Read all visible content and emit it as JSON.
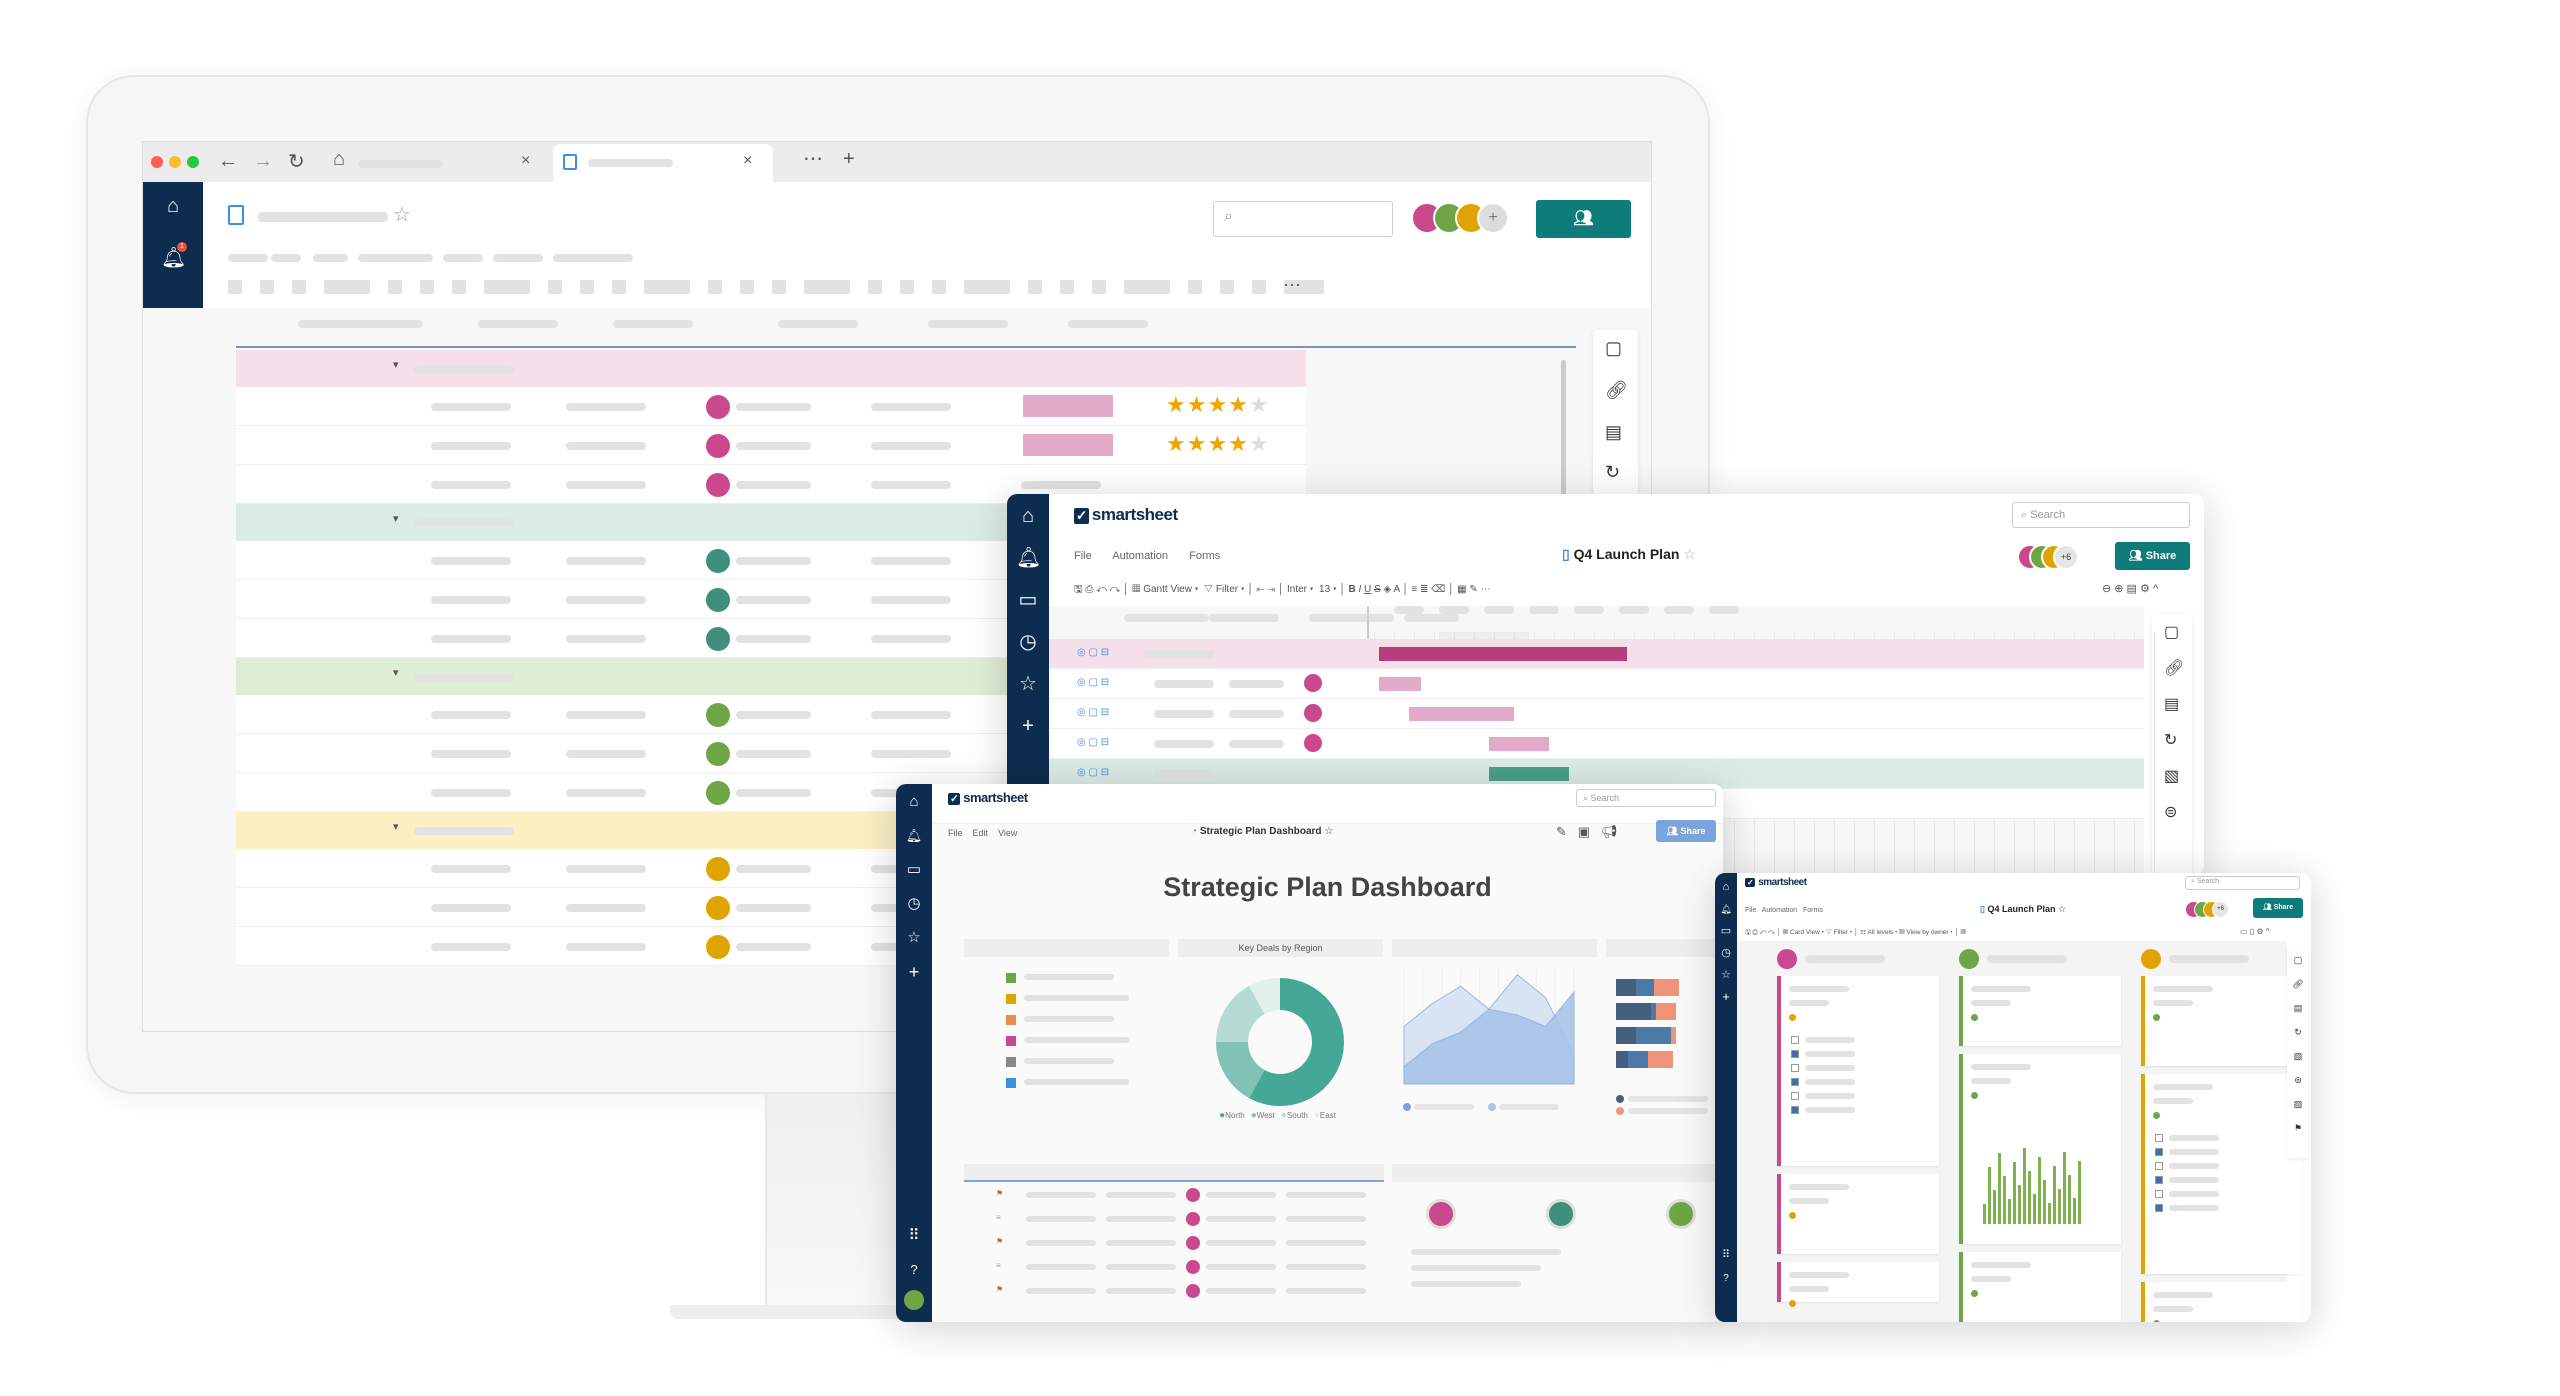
{
  "main_sheet": {
    "notification_count": "1",
    "groups": [
      {
        "color": "#f5dfe9",
        "avatar": "#c9498c",
        "rows": 3,
        "ratings": [
          4,
          4,
          null
        ]
      },
      {
        "color": "#dbebe6",
        "avatar": "#3f8f7a",
        "rows": 3,
        "ratings": [
          null,
          null,
          null
        ]
      },
      {
        "color": "#dfecd6",
        "avatar": "#6ea545",
        "rows": 3,
        "ratings": [
          null,
          null,
          null
        ]
      },
      {
        "color": "#fcefc4",
        "avatar": "#e0a400",
        "rows": 3,
        "ratings": [
          null,
          null,
          null
        ]
      }
    ]
  },
  "gantt_window": {
    "logo": "smartsheet",
    "search_placeholder": "Search",
    "menu": [
      "File",
      "Automation",
      "Forms"
    ],
    "title": "Q4 Launch Plan",
    "collaborators_more": "+6",
    "share_label": "Share",
    "toolbar": {
      "view": "Gantt View",
      "filter": "Filter",
      "font": "Inter",
      "font_size": "13"
    }
  },
  "dashboard_window": {
    "logo": "smartsheet",
    "search_placeholder": "Search",
    "menu": [
      "File",
      "Edit",
      "View"
    ],
    "title": "Strategic Plan Dashboard",
    "heading": "Strategic Plan Dashboard",
    "share_label": "Share",
    "widget_title": "Key Deals by Region"
  },
  "card_window": {
    "logo": "smartsheet",
    "search_placeholder": "Search",
    "menu": [
      "File",
      "Automation",
      "Forms"
    ],
    "title": "Q4 Launch Plan",
    "collaborators_more": "+6",
    "share_label": "Share",
    "toolbar": {
      "view": "Card View",
      "filter": "Filter",
      "levels": "All levels",
      "view_by": "View by owner"
    },
    "lanes": [
      {
        "color": "#c9498c"
      },
      {
        "color": "#6ea545"
      },
      {
        "color": "#e0a400"
      }
    ]
  },
  "colors": {
    "navy": "#0d2c4f",
    "share": "#0e7c7b",
    "teal": "#45a796",
    "blue": "#7ba3dc"
  },
  "chart_data": [
    {
      "type": "pie",
      "title": "Key Deals by Region",
      "categories": [
        "North",
        "West",
        "South",
        "East"
      ],
      "values": [
        58,
        17,
        17,
        8
      ],
      "colors": [
        "#45a796",
        "#80c2b5",
        "#b5dbd2",
        "#e2f0ec"
      ],
      "legend": "bottom"
    },
    {
      "type": "area",
      "series": [
        {
          "values": [
            5,
            7,
            8.5,
            6.5,
            9.5,
            7.5,
            2.5
          ]
        },
        {
          "values": [
            1.5,
            3.5,
            4.5,
            6.5,
            6,
            5,
            8
          ]
        }
      ],
      "colors": [
        "#d5e2f4",
        "#a9c4ea"
      ]
    },
    {
      "type": "bar",
      "stacked": true,
      "orientation": "horizontal",
      "series": [
        {
          "values": [
            2,
            3.5,
            2,
            1.2
          ]
        },
        {
          "values": [
            1.8,
            0.5,
            3.5,
            2
          ]
        },
        {
          "values": [
            2.5,
            2,
            0.5,
            2.5
          ]
        }
      ],
      "colors": [
        "#44607c",
        "#4a7aa5",
        "#ef9478"
      ]
    }
  ]
}
